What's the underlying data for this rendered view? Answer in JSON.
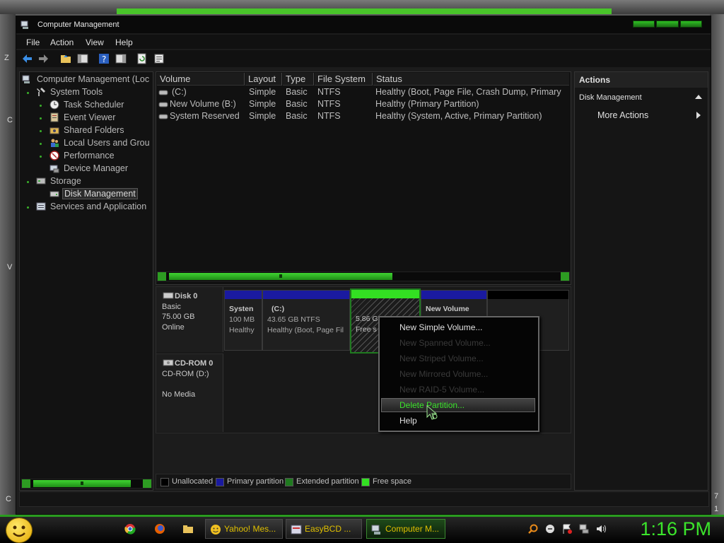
{
  "window": {
    "title": "Computer Management"
  },
  "menu": [
    "File",
    "Action",
    "View",
    "Help"
  ],
  "tree": {
    "root": "Computer Management (Loc",
    "items": [
      {
        "label": "System Tools",
        "level": 1,
        "icon": "tools-icon"
      },
      {
        "label": "Task Scheduler",
        "level": 2,
        "icon": "clock-icon"
      },
      {
        "label": "Event Viewer",
        "level": 2,
        "icon": "event-viewer-icon"
      },
      {
        "label": "Shared Folders",
        "level": 2,
        "icon": "shared-folders-icon"
      },
      {
        "label": "Local Users and Grou",
        "level": 2,
        "icon": "users-icon"
      },
      {
        "label": "Performance",
        "level": 2,
        "icon": "performance-icon"
      },
      {
        "label": "Device Manager",
        "level": 2,
        "icon": "device-manager-icon"
      },
      {
        "label": "Storage",
        "level": 1,
        "icon": "storage-icon"
      },
      {
        "label": "Disk Management",
        "level": 2,
        "icon": "disk-icon",
        "selected": true
      },
      {
        "label": "Services and Application",
        "level": 1,
        "icon": "services-icon"
      }
    ]
  },
  "volumes": {
    "headers": [
      "Volume",
      "Layout",
      "Type",
      "File System",
      "Status"
    ],
    "rows": [
      [
        "(C:)",
        "Simple",
        "Basic",
        "NTFS",
        "Healthy (Boot, Page File, Crash Dump, Primary"
      ],
      [
        "New Volume (B:)",
        "Simple",
        "Basic",
        "NTFS",
        "Healthy (Primary Partition)"
      ],
      [
        "System Reserved",
        "Simple",
        "Basic",
        "NTFS",
        "Healthy (System, Active, Primary Partition)"
      ]
    ]
  },
  "disks": {
    "disk0": {
      "name": "Disk 0",
      "type": "Basic",
      "size": "75.00 GB",
      "state": "Online",
      "parts": [
        {
          "name": "Systen",
          "line1": "100 MB",
          "line2": "Healthy"
        },
        {
          "name": "(C:)",
          "line1": "43.65 GB NTFS",
          "line2": "Healthy (Boot, Page Fil"
        },
        {
          "name": "",
          "line1": "5.86 G",
          "line2": "Free s"
        },
        {
          "name": "New Volume",
          "line1": "",
          "line2": ""
        }
      ]
    },
    "cdrom": {
      "name": "CD-ROM 0",
      "type": "CD-ROM (D:)",
      "state": "No Media"
    }
  },
  "legend": [
    "Unallocated",
    "Primary partition",
    "Extended partition",
    "Free space"
  ],
  "colors": {
    "unallocated": "#000000",
    "primary": "#1a1aa0",
    "extended": "#1f7a1f",
    "free": "#33e022",
    "accent": "#3be42b"
  },
  "actions": {
    "header": "Actions",
    "section": "Disk Management",
    "more": "More Actions"
  },
  "context_menu": {
    "items": [
      {
        "label": "New Simple Volume...",
        "enabled": true
      },
      {
        "label": "New Spanned Volume...",
        "enabled": false
      },
      {
        "label": "New Striped Volume...",
        "enabled": false
      },
      {
        "label": "New Mirrored Volume...",
        "enabled": false
      },
      {
        "label": "New RAID-5 Volume...",
        "enabled": false
      },
      {
        "label": "Delete Partition...",
        "enabled": true,
        "highlighted": true
      },
      {
        "label": "Help",
        "enabled": true
      }
    ]
  },
  "taskbar": {
    "buttons": [
      "Yahoo! Mes...",
      "EasyBCD ...",
      "Computer M..."
    ],
    "clock": "1:16 PM"
  },
  "desktop_chars": [
    "Z",
    "C",
    "V",
    "C",
    "7",
    "1"
  ]
}
